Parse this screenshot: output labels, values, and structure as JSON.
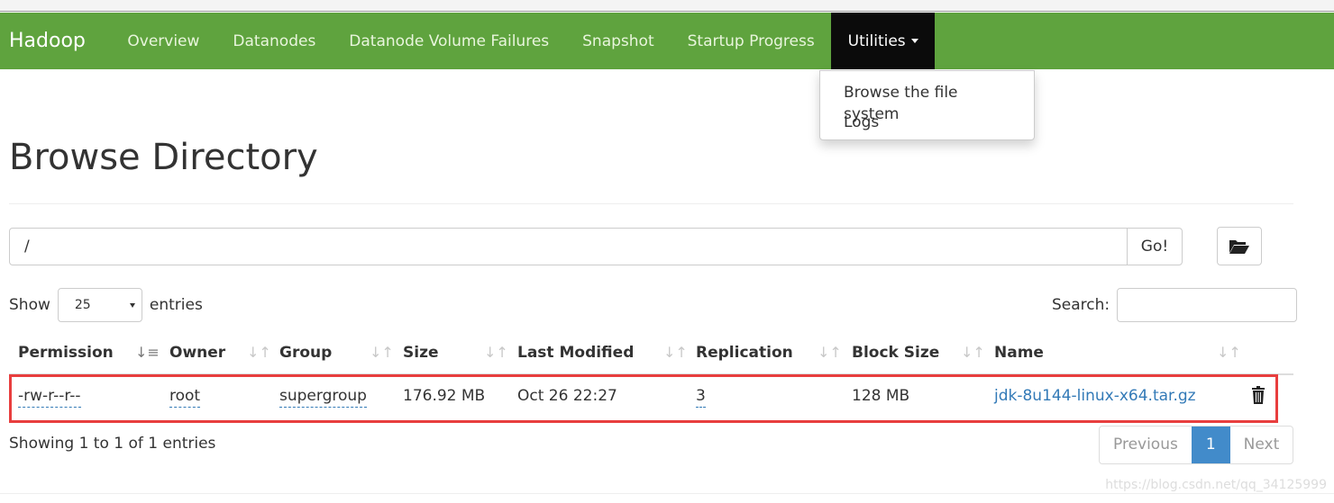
{
  "navbar": {
    "brand": "Hadoop",
    "items": [
      "Overview",
      "Datanodes",
      "Datanode Volume Failures",
      "Snapshot",
      "Startup Progress"
    ],
    "active": "Utilities",
    "bg_color": "#5fa33e"
  },
  "dropdown": {
    "items": [
      "Browse the file system",
      "Logs"
    ]
  },
  "page_title": "Browse Directory",
  "path": {
    "value": "/",
    "go_label": "Go!"
  },
  "length": {
    "show": "Show",
    "value": "25",
    "entries": "entries"
  },
  "search": {
    "label": "Search:",
    "value": ""
  },
  "table": {
    "columns": [
      "Permission",
      "Owner",
      "Group",
      "Size",
      "Last Modified",
      "Replication",
      "Block Size",
      "Name"
    ],
    "rows": [
      {
        "permission": "-rw-r--r--",
        "owner": "root",
        "group": "supergroup",
        "size": "176.92 MB",
        "modified": "Oct 26 22:27",
        "replication": "3",
        "block_size": "128 MB",
        "name": "jdk-8u144-linux-x64.tar.gz"
      }
    ]
  },
  "info": "Showing 1 to 1 of 1 entries",
  "pagination": {
    "previous": "Previous",
    "current": "1",
    "next": "Next"
  },
  "watermark": "https://blog.csdn.net/qq_34125999"
}
